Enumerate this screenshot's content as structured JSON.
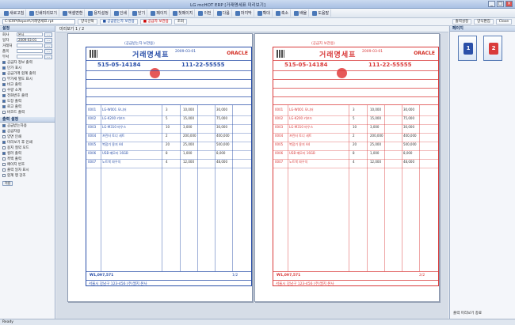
{
  "window": {
    "title": "LG mcHOT ERP  [거래명세표 미리보기]"
  },
  "toolbar": {
    "items": [
      "새로고침",
      "인쇄미리보기",
      "엑셀변환",
      "용지설정",
      "인쇄",
      "닫기",
      "페이지",
      "첫페이지",
      "이전",
      "다음",
      "마지막",
      "확대",
      "축소",
      "배율",
      "도움말"
    ]
  },
  "toolbar2": {
    "path": "C:\\ERP\\Report\\거래명세표.rpt",
    "pills": [
      {
        "label": "양식선택",
        "style": ""
      },
      {
        "label": "■ 공급받는자 보관용",
        "style": "blue"
      },
      {
        "label": "■ 공급자 보관용",
        "style": "red"
      },
      {
        "label": "조회",
        "style": ""
      }
    ],
    "right_pills": [
      "출력설정",
      "양식편집",
      "Close"
    ]
  },
  "sidebar": {
    "section1": "설정",
    "fields": [
      {
        "label": "회사",
        "value": "본사"
      },
      {
        "label": "일자",
        "value": "2009-03-01"
      },
      {
        "label": "거래처",
        "value": ""
      },
      {
        "label": "품목",
        "value": ""
      },
      {
        "label": "부서",
        "value": ""
      }
    ],
    "options": [
      {
        "label": "공급자 정보 출력",
        "on": true
      },
      {
        "label": "단가 표시",
        "on": true
      },
      {
        "label": "공급가액 합계 출력",
        "on": true
      },
      {
        "label": "부가세 별도 표시",
        "on": false
      },
      {
        "label": "비고 출력",
        "on": true
      },
      {
        "label": "수량 소계",
        "on": false
      },
      {
        "label": "전화번호 출력",
        "on": true
      },
      {
        "label": "도장 출력",
        "on": true
      },
      {
        "label": "로고 출력",
        "on": true
      },
      {
        "label": "바코드 출력",
        "on": false
      }
    ],
    "section2": "출력 설정",
    "options2": [
      {
        "label": "공급받는자용",
        "on": true
      },
      {
        "label": "공급자용",
        "on": true
      },
      {
        "label": "양면 인쇄",
        "on": false
      },
      {
        "label": "미리보기 후 인쇄",
        "on": true
      },
      {
        "label": "용지 절약 모드",
        "on": false
      },
      {
        "label": "컬러 출력",
        "on": true
      },
      {
        "label": "흑백 출력",
        "on": false
      },
      {
        "label": "페이지 번호",
        "on": false
      },
      {
        "label": "출력 일자 표시",
        "on": false
      },
      {
        "label": "합계 행 강조",
        "on": false
      }
    ],
    "apply_label": "적용"
  },
  "main": {
    "header": "미리보기 1 / 2",
    "pages": [
      {
        "theme": "blue",
        "copy_label": "(공급받는자 보관용)",
        "title": "거래명세표",
        "logo": "ORACLE",
        "supplier_regno": "515-05-14184",
        "buyer_regno": "111-22-55555",
        "date": "2009-03-01",
        "items": [
          {
            "no": "0001",
            "name": "LG-W001 모니터",
            "qty": "3",
            "price": "10,000",
            "amount": "30,000"
          },
          {
            "no": "0002",
            "name": "LG-K200 키보드",
            "qty": "5",
            "price": "15,000",
            "amount": "75,000"
          },
          {
            "no": "0003",
            "name": "LG-M310 마우스",
            "qty": "10",
            "price": "3,000",
            "amount": "30,000"
          },
          {
            "no": "0004",
            "name": "프린터 토너 세트",
            "qty": "2",
            "price": "200,000",
            "amount": "400,000"
          },
          {
            "no": "0005",
            "name": "복합기 용지 A4",
            "qty": "20",
            "price": "25,000",
            "amount": "500,000"
          },
          {
            "no": "0006",
            "name": "USB 메모리 16GB",
            "qty": "8",
            "price": "1,000",
            "amount": "8,000"
          },
          {
            "no": "0007",
            "name": "노트북 파우치",
            "qty": "4",
            "price": "12,000",
            "amount": "48,000"
          }
        ],
        "total": "₩1,097,571",
        "footer_addr": "서울시 강남구 123-456 (주)엘지 본사",
        "footer_page": "1/2"
      },
      {
        "theme": "red",
        "copy_label": "(공급자 보관용)",
        "title": "거래명세표",
        "logo": "ORACLE",
        "supplier_regno": "515-05-14184",
        "buyer_regno": "111-22-55555",
        "date": "2009-03-01",
        "items": [
          {
            "no": "0001",
            "name": "LG-W001 모니터",
            "qty": "3",
            "price": "10,000",
            "amount": "30,000"
          },
          {
            "no": "0002",
            "name": "LG-K200 키보드",
            "qty": "5",
            "price": "15,000",
            "amount": "75,000"
          },
          {
            "no": "0003",
            "name": "LG-M310 마우스",
            "qty": "10",
            "price": "3,000",
            "amount": "30,000"
          },
          {
            "no": "0004",
            "name": "프린터 토너 세트",
            "qty": "2",
            "price": "200,000",
            "amount": "400,000"
          },
          {
            "no": "0005",
            "name": "복합기 용지 A4",
            "qty": "20",
            "price": "25,000",
            "amount": "500,000"
          },
          {
            "no": "0006",
            "name": "USB 메모리 16GB",
            "qty": "8",
            "price": "1,000",
            "amount": "8,000"
          },
          {
            "no": "0007",
            "name": "노트북 파우치",
            "qty": "4",
            "price": "12,000",
            "amount": "48,000"
          }
        ],
        "total": "₩1,097,571",
        "footer_addr": "서울시 강남구 123-456 (주)엘지 본사",
        "footer_page": "2/2"
      }
    ]
  },
  "rpanel": {
    "title": "페이지",
    "thumbs": [
      {
        "label": "1",
        "color": "#2a4fa8"
      },
      {
        "label": "2",
        "color": "#d93a3a"
      }
    ],
    "bottom": "출력 미리보기 종료"
  },
  "status": {
    "text": "Ready"
  }
}
